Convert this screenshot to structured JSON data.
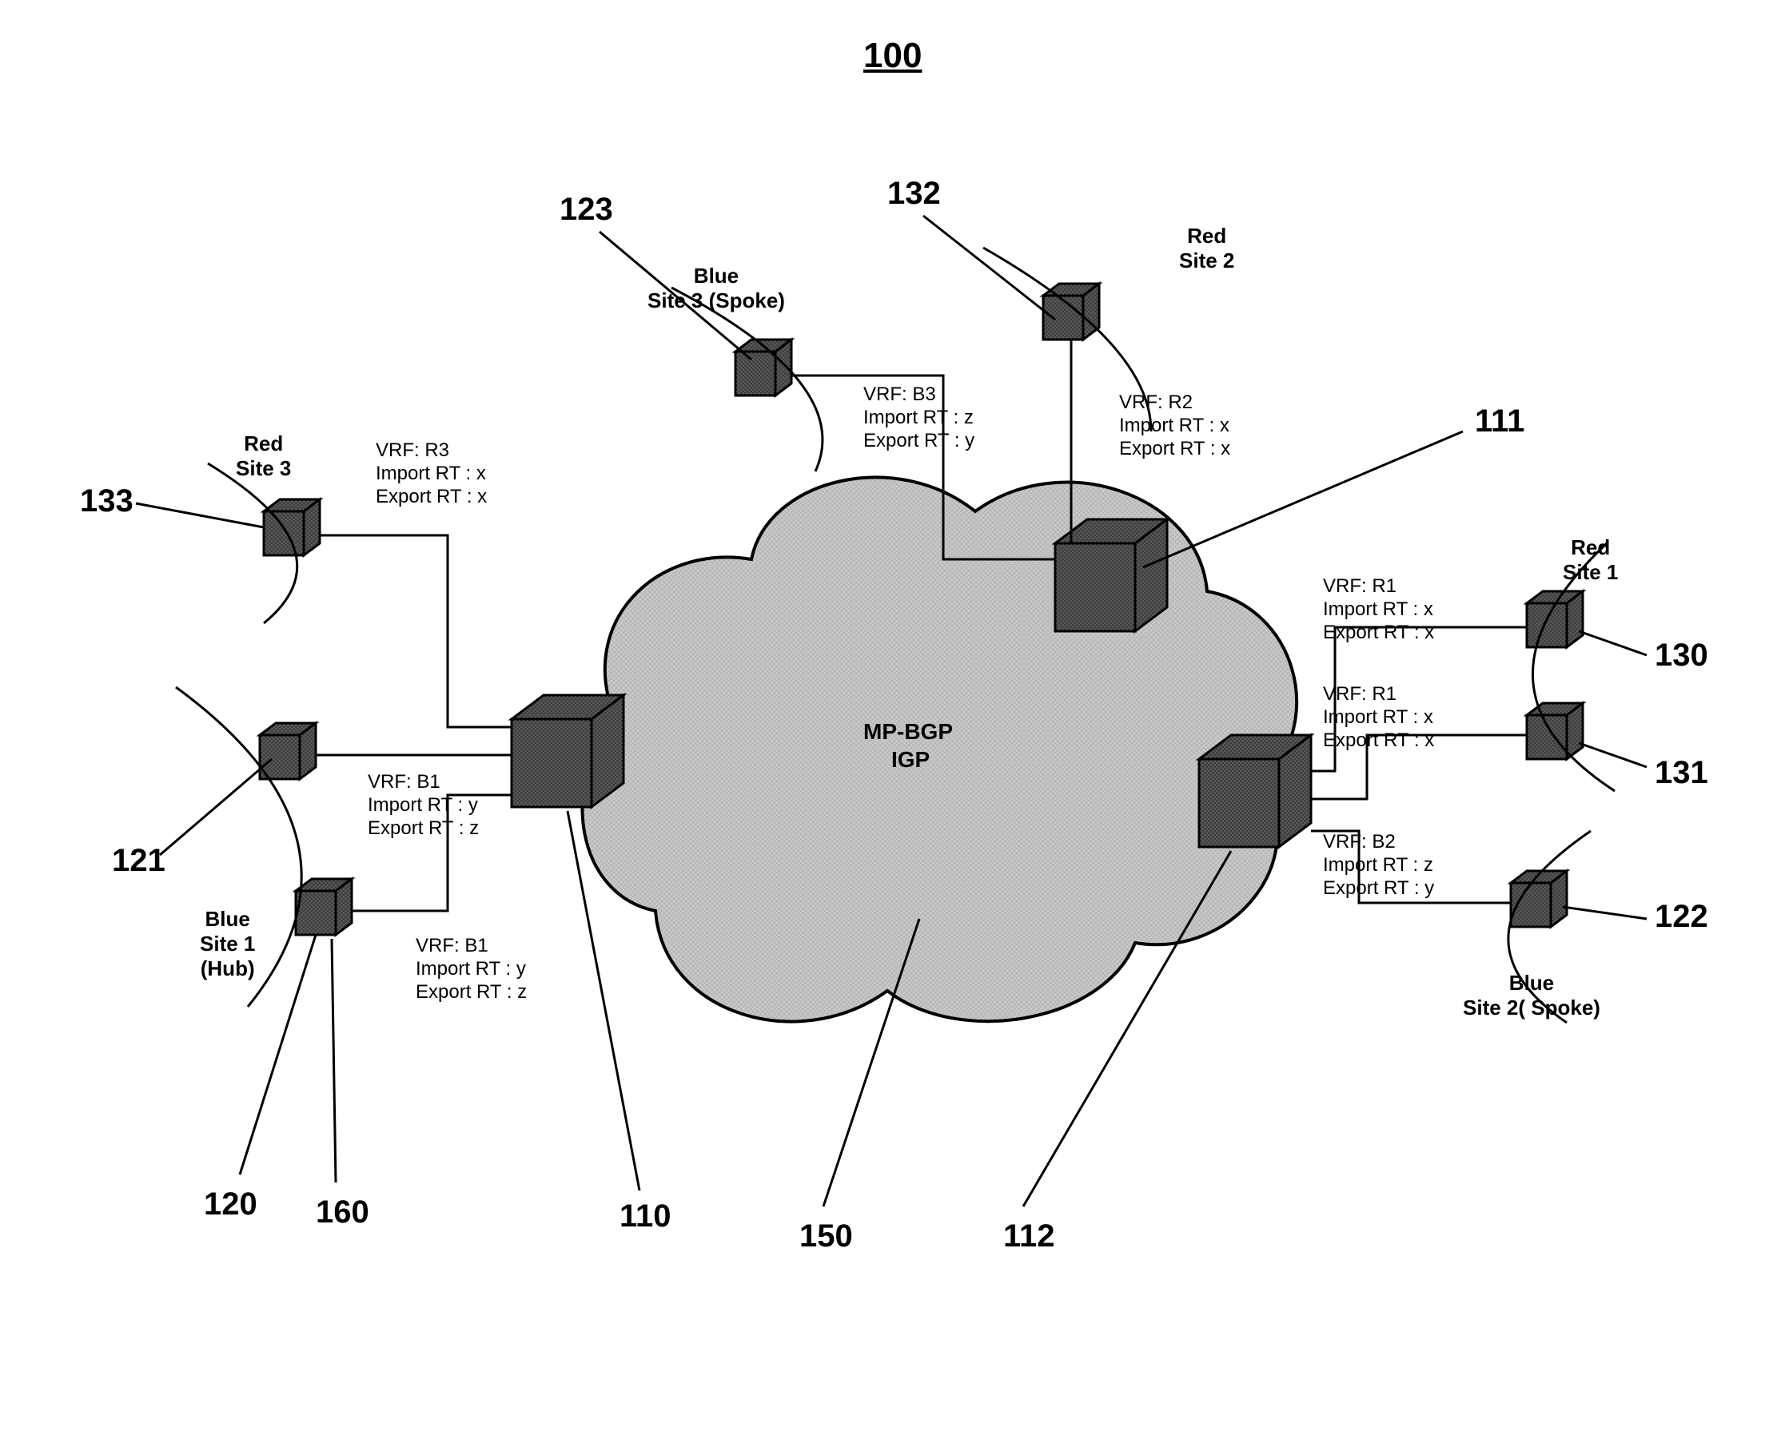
{
  "figure_number": "100",
  "cloud": {
    "line1": "MP-BGP",
    "line2": "IGP"
  },
  "callouts": {
    "c110": "110",
    "c111": "111",
    "c112": "112",
    "c120": "120",
    "c121": "121",
    "c122": "122",
    "c123": "123",
    "c130": "130",
    "c131": "131",
    "c132": "132",
    "c133": "133",
    "c150": "150",
    "c160": "160"
  },
  "sites": {
    "red1": "Red\nSite 1",
    "red2": "Red\nSite 2",
    "red3": "Red\nSite 3",
    "blue1": "Blue\nSite 1\n(Hub)",
    "blue2": "Blue\nSite 2( Spoke)",
    "blue3": "Blue\nSite 3 (Spoke)"
  },
  "vrf": {
    "r1a": "VRF: R1\nImport RT : x\nExport RT : x",
    "r1b": "VRF: R1\nImport RT : x\nExport RT : x",
    "r2": "VRF: R2\nImport RT : x\nExport RT : x",
    "r3": "VRF: R3\nImport RT : x\nExport RT : x",
    "b1a": "VRF: B1\nImport RT : y\nExport RT : z",
    "b1b": "VRF: B1\nImport RT : y\nExport RT : z",
    "b2": "VRF: B2\nImport RT : z\nExport RT : y",
    "b3": "VRF: B3\nImport RT : z\nExport RT : y"
  },
  "chart_data": {
    "type": "network-diagram",
    "title": "100",
    "core": {
      "id": 150,
      "protocols": [
        "MP-BGP",
        "IGP"
      ]
    },
    "pe_routers": [
      {
        "id": 110,
        "vrfs": [
          "R3",
          "B1",
          "B1"
        ]
      },
      {
        "id": 111,
        "vrfs": [
          "B3",
          "R2"
        ]
      },
      {
        "id": 112,
        "vrfs": [
          "R1",
          "R1",
          "B2"
        ]
      }
    ],
    "vrfs": [
      {
        "name": "R1",
        "import_rt": "x",
        "export_rt": "x"
      },
      {
        "name": "R2",
        "import_rt": "x",
        "export_rt": "x"
      },
      {
        "name": "R3",
        "import_rt": "x",
        "export_rt": "x"
      },
      {
        "name": "B1",
        "import_rt": "y",
        "export_rt": "z"
      },
      {
        "name": "B2",
        "import_rt": "z",
        "export_rt": "y"
      },
      {
        "name": "B3",
        "import_rt": "z",
        "export_rt": "y"
      }
    ],
    "ce_devices": [
      {
        "id": 120,
        "site": "Blue Site 1 (Hub)",
        "multihomed_ref": 160,
        "connects_to_pe": 110,
        "vrf": "B1"
      },
      {
        "id": 121,
        "site": "Blue Site 1 (Hub)",
        "connects_to_pe": 110,
        "vrf": "B1"
      },
      {
        "id": 122,
        "site": "Blue Site 2 (Spoke)",
        "connects_to_pe": 112,
        "vrf": "B2"
      },
      {
        "id": 123,
        "site": "Blue Site 3 (Spoke)",
        "connects_to_pe": 111,
        "vrf": "B3"
      },
      {
        "id": 130,
        "site": "Red Site 1",
        "connects_to_pe": 112,
        "vrf": "R1"
      },
      {
        "id": 131,
        "site": "Red Site 1",
        "connects_to_pe": 112,
        "vrf": "R1"
      },
      {
        "id": 132,
        "site": "Red Site 2",
        "connects_to_pe": 111,
        "vrf": "R2"
      },
      {
        "id": 133,
        "site": "Red Site 3",
        "connects_to_pe": 110,
        "vrf": "R3"
      }
    ]
  }
}
